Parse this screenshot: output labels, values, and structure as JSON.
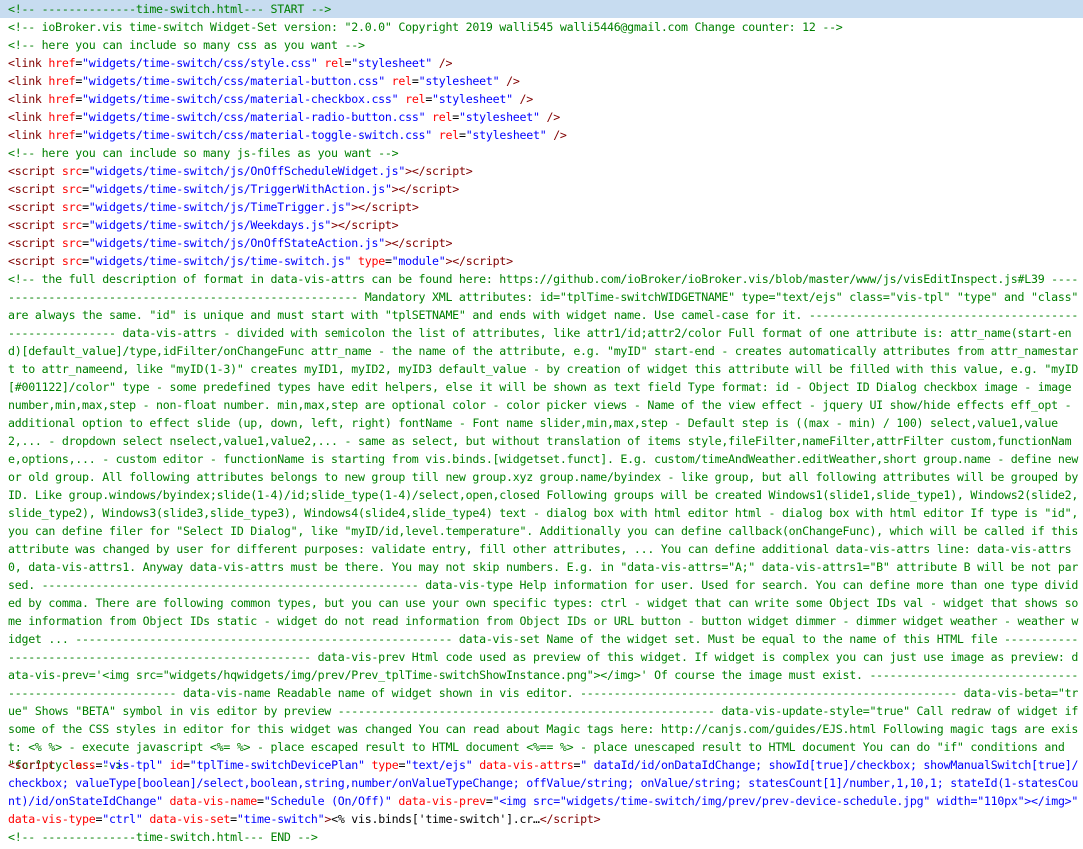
{
  "source": {
    "start_marker": "<!-- --------------time-switch.html--- START -->",
    "header_comment": "<!-- ioBroker.vis time-switch Widget-Set version: \"2.0.0\" Copyright 2019 walli545 walli5446@gmail.com Change counter: 12 -->",
    "css_comment": "<!-- here you can include so many css as you want -->",
    "css_links": [
      "widgets/time-switch/css/style.css",
      "widgets/time-switch/css/material-button.css",
      "widgets/time-switch/css/material-checkbox.css",
      "widgets/time-switch/css/material-radio-button.css",
      "widgets/time-switch/css/material-toggle-switch.css"
    ],
    "js_comment": "<!-- here you can include so many js-files as you want -->",
    "js_scripts": [
      "widgets/time-switch/js/OnOffScheduleWidget.js",
      "widgets/time-switch/js/TriggerWithAction.js",
      "widgets/time-switch/js/TimeTrigger.js",
      "widgets/time-switch/js/Weekdays.js",
      "widgets/time-switch/js/OnOffStateAction.js",
      "widgets/time-switch/js/time-switch.js"
    ],
    "module_type": "module",
    "long_comment": "<!-- the full description of format in data-vis-attrs can be found here: https://github.com/ioBroker/ioBroker.vis/blob/master/www/js/visEditInspect.js#L39 -------------------------------------------------------- Mandatory XML attributes: id=\"tplTime-switchWIDGETNAME\" type=\"text/ejs\" class=\"vis-tpl\" \"type\" and \"class\" are always the same. \"id\" is unique and must start with \"tplSETNAME\" and ends with widget name. Use camel-case for it. -------------------------------------------------------- data-vis-attrs - divided with semicolon the list of attributes, like attr1/id;attr2/color Full format of one attribute is: attr_name(start-end)[default_value]/type,idFilter/onChangeFunc attr_name - the name of the attribute, e.g. \"myID\" start-end - creates automatically attributes from attr_namestart to attr_nameend, like \"myID(1-3)\" creates myID1, myID2, myID3 default_value - by creation of widget this attribute will be filled with this value, e.g. \"myID[#001122]/color\" type - some predefined types have edit helpers, else it will be shown as text field Type format: id - Object ID Dialog checkbox image - image number,min,max,step - non-float number. min,max,step are optional color - color picker views - Name of the view effect - jquery UI show/hide effects eff_opt - additional option to effect slide (up, down, left, right) fontName - Font name slider,min,max,step - Default step is ((max - min) / 100) select,value1,value2,... - dropdown select nselect,value1,value2,... - same as select, but without translation of items style,fileFilter,nameFilter,attrFilter custom,functionName,options,... - custom editor - functionName is starting from vis.binds.[widgetset.funct]. E.g. custom/timeAndWeather.editWeather,short group.name - define new or old group. All following attributes belongs to new group till new group.xyz group.name/byindex - like group, but all following attributes will be grouped by ID. Like group.windows/byindex;slide(1-4)/id;slide_type(1-4)/select,open,closed Following groups will be created Windows1(slide1,slide_type1), Windows2(slide2,slide_type2), Windows3(slide3,slide_type3), Windows4(slide4,slide_type4) text - dialog box with html editor html - dialog box with html editor If type is \"id\", you can define filer for \"Select ID Dialog\", like \"myID/id,level.temperature\". Additionally you can define callback(onChangeFunc), which will be called if this attribute was changed by user for different purposes: validate entry, fill other attributes, ... You can define additional data-vis-attrs line: data-vis-attrs0, data-vis-attrs1. Anyway data-vis-attrs must be there. You may not skip numbers. E.g. in \"data-vis-attrs=\"A;\" data-vis-attrs1=\"B\" attribute B will be not parsed. -------------------------------------------------------- data-vis-type Help information for user. Used for search. You can define more than one type divided by comma. There are following common types, but you can use your own specific types: ctrl - widget that can write some Object IDs val - widget that shows some information from Object IDs static - widget do not read information from Object IDs or URL button - button widget dimmer - dimmer widget weather - weather widget ... -------------------------------------------------------- data-vis-set Name of the widget set. Must be equal to the name of this HTML file -------------------------------------------------------- data-vis-prev Html code used as preview of this widget. If widget is complex you can just use image as preview: data-vis-prev='<img src=\"widgets/hqwidgets/img/prev/Prev_tplTime-switchShowInstance.png\"></img>' Of course the image must exist. -------------------------------------------------------- data-vis-name Readable name of widget shown in vis editor. -------------------------------------------------------- data-vis-beta=\"true\" Shows \"BETA\" symbol in vis editor by preview -------------------------------------------------------- data-vis-update-style=\"true\" Call redraw of widget if some of the CSS styles in editor for this widget was changed You can read about Magic tags here: http://canjs.com/guides/EJS.html Following magic tags are exist: <% %> - execute javascript <%= %> - place escaped result to HTML document <%== %> - place unescaped result to HTML document You can do \"if\" conditions and \"for\" cycles. -->",
    "template_script": {
      "class": "vis-tpl",
      "id": "tplTime-switchDevicePlan",
      "type": "text/ejs",
      "data_vis_attrs": "dataId/id/onDataIdChange; showId[true]/checkbox; showManualSwitch[true]/checkbox; valueType[boolean]/select,boolean,string,number/onValueTypeChange; offValue/string; onValue/string; statesCount[1]/number,1,10,1; stateId(1-statesCount)/id/onStateIdChange",
      "data_vis_name": "Schedule (On/Off)",
      "data_vis_prev": "<img src=\"widgets/time-switch/img/prev/prev-device-schedule.jpg\" width=\"110px\"></img>",
      "data_vis_type": "ctrl",
      "data_vis_set": "time-switch",
      "body": "<% vis.binds['time-switch'].cr…"
    },
    "end_marker": "<!-- --------------time-switch.html--- END -->"
  }
}
